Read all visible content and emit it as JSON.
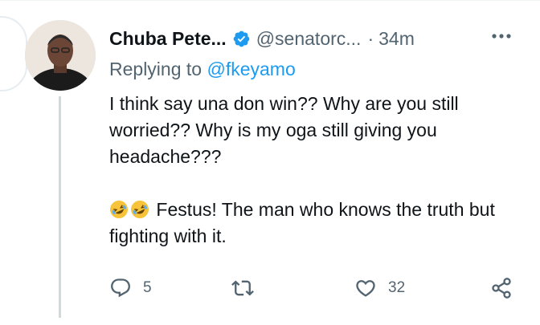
{
  "tweet": {
    "author_name": "Chuba Pete...",
    "handle": "@senatorc...",
    "separator": "·",
    "time": "34m",
    "reply_prefix": "Replying to",
    "reply_to": "@fkeyamo",
    "paragraph1": "I think say una don win?? Why are you still worried?? Why is my oga still giving you headache???",
    "paragraph2": "Festus! The man who knows the truth but fighting with it.",
    "emoji_name": "rolling-on-the-floor-laughing-emoji"
  },
  "actions": {
    "reply_count": "5",
    "retweet_count": "",
    "like_count": "32"
  },
  "colors": {
    "accent": "#1d9bf0",
    "text_primary": "#0f1419",
    "text_secondary": "#536471",
    "thread_line": "#cfd9de"
  },
  "icons": [
    "chevron-right-icon",
    "verified-badge-icon",
    "more-icon",
    "reply-icon",
    "retweet-icon",
    "like-icon",
    "share-icon"
  ]
}
